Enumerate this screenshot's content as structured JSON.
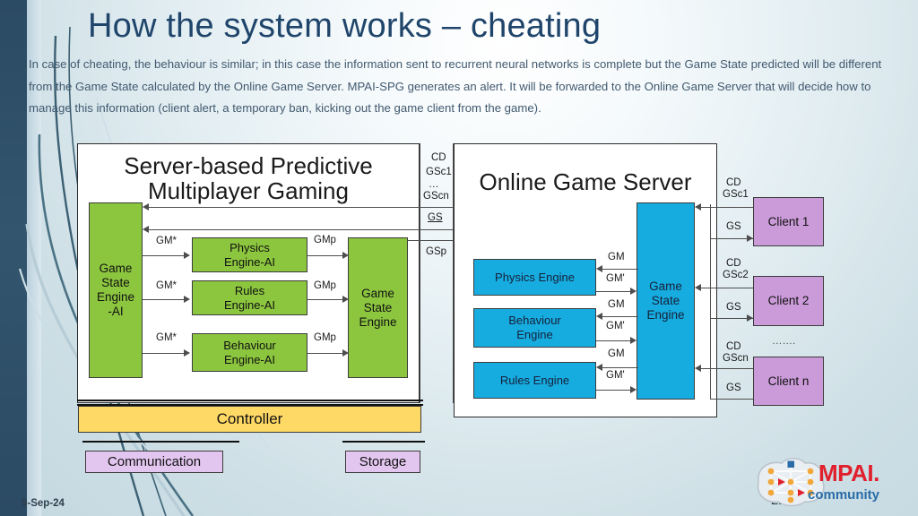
{
  "slide": {
    "title": "How the system works – cheating",
    "body": "In case of cheating, the behaviour is similar; in this case the information sent to recurrent neural networks is complete but the Game State predicted will be different from the Game State calculated by the Online Game Server. MPAI-SPG generates an alert. It will be forwarded to the Online Game Server that will decide how to manage this information (client alert, a temporary ban, kicking out the game client from the game).",
    "date": "9-Sep-24",
    "page_number": "22",
    "logo_text": "MPAI.",
    "logo_sub": "community"
  },
  "colors": {
    "title": "#20456b",
    "body": "#41596f",
    "green": "#8cc63f",
    "blue": "#16ace0",
    "purple": "#cb9bd9",
    "yellow": "#ffd966",
    "lilac": "#e3c6ef",
    "background": "#c9dce3",
    "edge_bar": "#2b4a63",
    "logo_red": "#e1202e",
    "logo_blue": "#2a6ca8"
  },
  "spg": {
    "title_line1": "Server-based Predictive",
    "title_line2": "Multiplayer Gaming",
    "gse_ai": "Game\nState\nEngine\n-AI",
    "gse_ai_lines": [
      "Game",
      "State",
      "Engine",
      "-AI"
    ],
    "engines": [
      {
        "line1": "Physics",
        "line2": "Engine-AI",
        "in_label": "GM*",
        "out_label": "GMp"
      },
      {
        "line1": "Rules",
        "line2": "Engine-AI",
        "in_label": "GM*",
        "out_label": "GMp"
      },
      {
        "line1": "Behaviour",
        "line2": "Engine-AI",
        "in_label": "GM*",
        "out_label": "GMp"
      }
    ],
    "gse_lines": [
      "Game",
      "State",
      "Engine"
    ]
  },
  "bus": {
    "cd_label_line1": "CD",
    "cd_label_line2": "GSc1",
    "cd_label_line3": "…",
    "cd_label_line4": "GScn",
    "gs_label": "GS",
    "gsp_label": "GSp"
  },
  "ogs": {
    "title": "Online Game Server",
    "engines": [
      {
        "name": "Physics Engine",
        "out_label": "GM",
        "in_label": "GM'"
      },
      {
        "name": "Behaviour\nEngine",
        "line1": "Behaviour",
        "line2": "Engine",
        "out_label": "GM",
        "in_label": "GM'"
      },
      {
        "name": "Rules Engine",
        "out_label": "GM",
        "in_label": "GM'"
      }
    ],
    "gse_lines": [
      "Game",
      "State",
      "Engine"
    ]
  },
  "clients": [
    {
      "name": "Client 1",
      "cd_line1": "CD",
      "cd_line2": "GSc1",
      "gs": "GS"
    },
    {
      "name": "Client 2",
      "cd_line1": "CD",
      "cd_line2": "GSc2",
      "gs": "GS"
    },
    {
      "name": "Client n",
      "cd_line1": "CD",
      "cd_line2": "GScn",
      "gs": "GS"
    }
  ],
  "clients_ellipsis": "…….",
  "bottom": {
    "controller": "Controller",
    "communication": "Communication",
    "storage": "Storage"
  }
}
